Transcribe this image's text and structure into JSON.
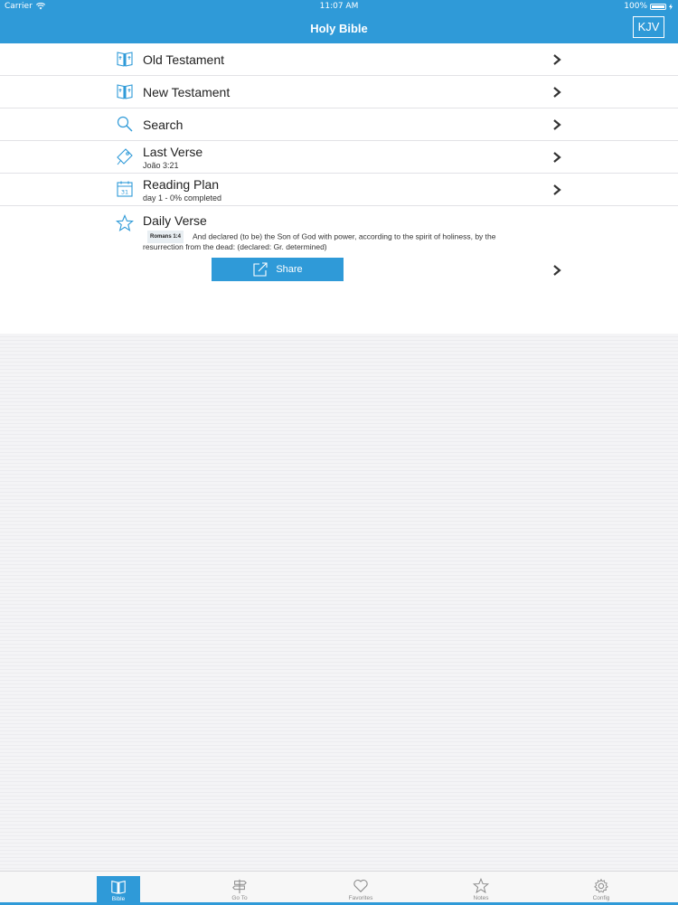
{
  "status": {
    "carrier": "Carrier",
    "time": "11:07 AM",
    "battery": "100%"
  },
  "nav": {
    "title": "Holy Bible",
    "version": "KJV"
  },
  "menu": [
    {
      "label": "Old Testament",
      "sub": "",
      "icon": "book-icon"
    },
    {
      "label": "New Testament",
      "sub": "",
      "icon": "book-icon"
    },
    {
      "label": "Search",
      "sub": "",
      "icon": "search-icon"
    },
    {
      "label": "Last Verse",
      "sub": "João 3:21",
      "icon": "pin-icon"
    },
    {
      "label": "Reading Plan",
      "sub": "day 1 - 0% completed",
      "icon": "calendar-icon",
      "calendar_day": "31"
    }
  ],
  "daily": {
    "label": "Daily Verse",
    "reference": "Romans 1:4",
    "text_line1": "And declared (to be) the Son of God with power, according to the spirit of holiness, by the",
    "text_line2": "resurrection from the dead: (declared: Gr. determined)",
    "share_label": "Share"
  },
  "tabs": [
    {
      "label": "Bible",
      "icon": "book-icon",
      "active": true
    },
    {
      "label": "Go To",
      "icon": "signpost-icon",
      "active": false
    },
    {
      "label": "Favorites",
      "icon": "heart-icon",
      "active": false
    },
    {
      "label": "Notes",
      "icon": "star-icon",
      "active": false
    },
    {
      "label": "Config",
      "icon": "gear-icon",
      "active": false
    }
  ],
  "colors": {
    "accent": "#2f9ad8",
    "background": "#efeff4",
    "panel": "#ffffff"
  }
}
